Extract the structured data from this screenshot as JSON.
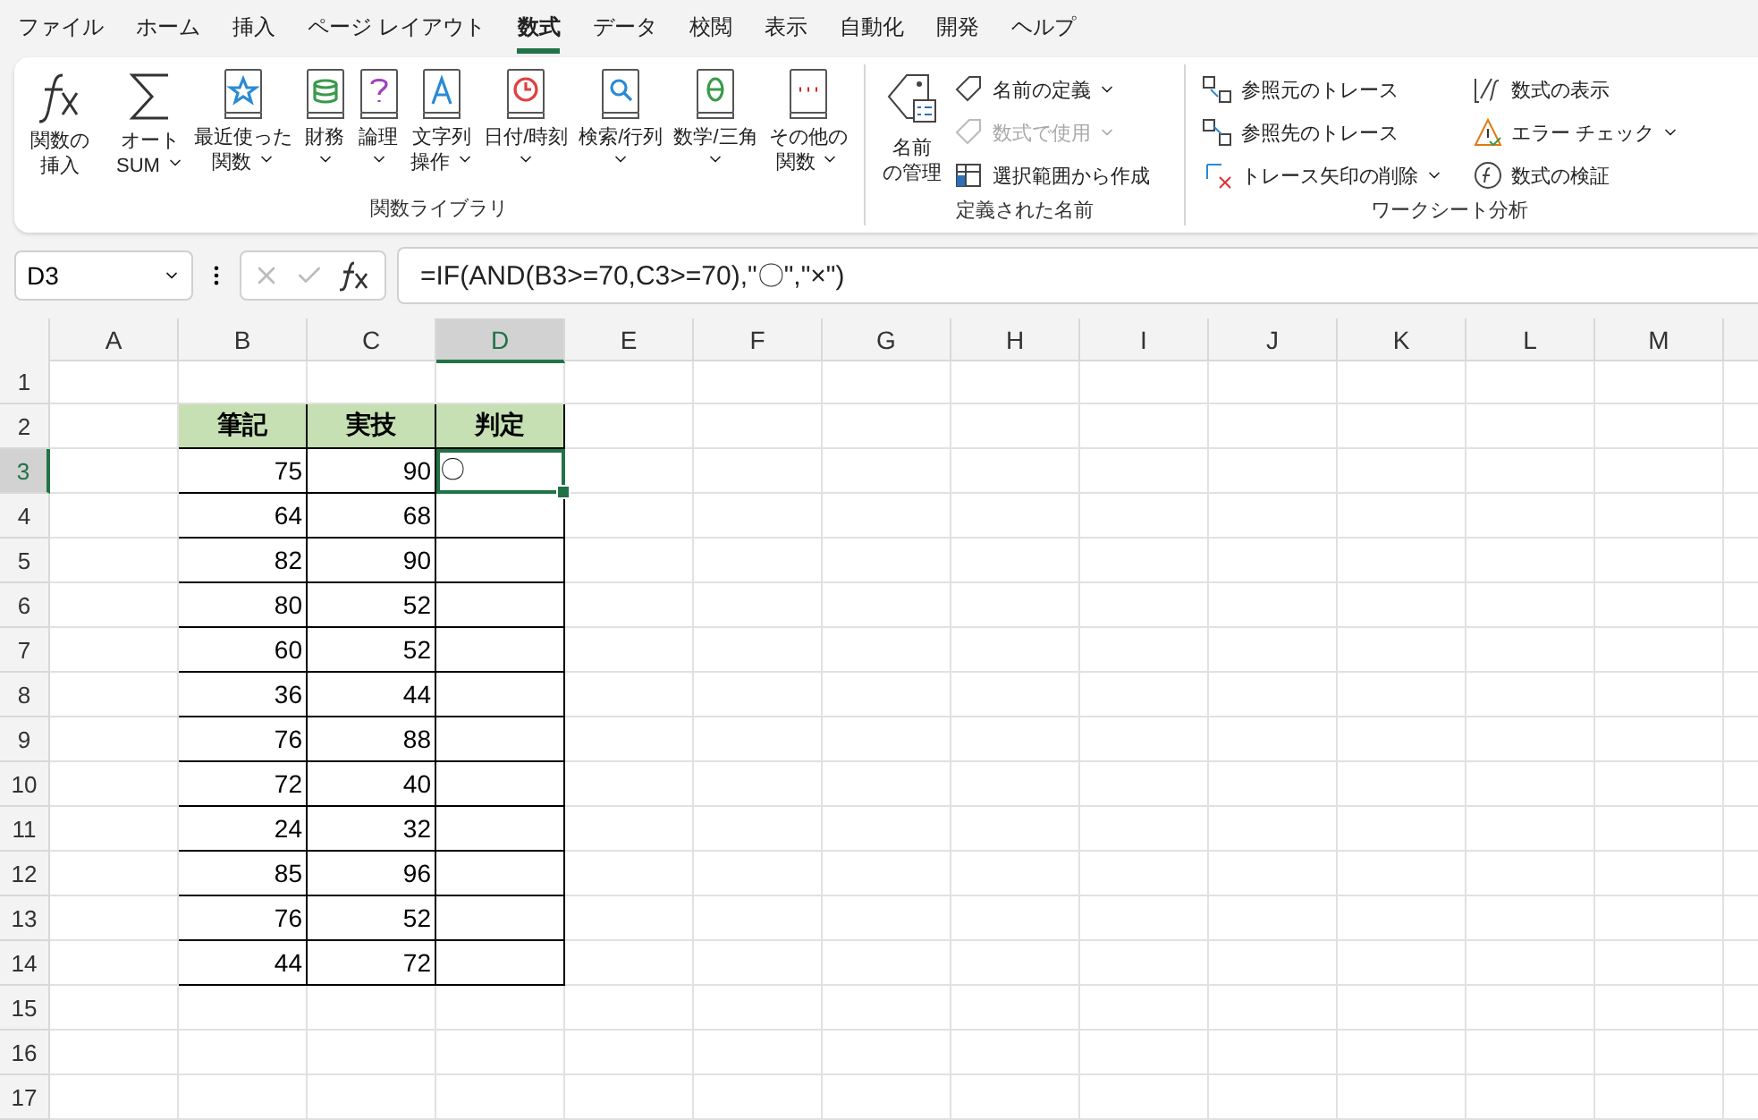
{
  "menu_tabs": [
    {
      "label": "ファイル",
      "selected": false
    },
    {
      "label": "ホーム",
      "selected": false
    },
    {
      "label": "挿入",
      "selected": false
    },
    {
      "label": "ページ レイアウト",
      "selected": false
    },
    {
      "label": "数式",
      "selected": true
    },
    {
      "label": "データ",
      "selected": false
    },
    {
      "label": "校閲",
      "selected": false
    },
    {
      "label": "表示",
      "selected": false
    },
    {
      "label": "自動化",
      "selected": false
    },
    {
      "label": "開発",
      "selected": false
    },
    {
      "label": "ヘルプ",
      "selected": false
    }
  ],
  "ribbon_groups": [
    {
      "label": "関数ライブラリ",
      "buttons": [
        {
          "kind": "large",
          "label": "関数の挿入",
          "dropdown": false
        },
        {
          "kind": "large",
          "label": "オートSUM",
          "dropdown": true
        },
        {
          "kind": "large",
          "label": "最近使った関数",
          "dropdown": true
        },
        {
          "kind": "large",
          "label": "財務",
          "dropdown": true
        },
        {
          "kind": "large",
          "label": "論理",
          "dropdown": true
        },
        {
          "kind": "large",
          "label": "文字列操作",
          "dropdown": true
        },
        {
          "kind": "large",
          "label": "日付/時刻",
          "dropdown": true
        },
        {
          "kind": "large",
          "label": "検索/行列",
          "dropdown": true
        },
        {
          "kind": "large",
          "label": "数学/三角",
          "dropdown": true
        },
        {
          "kind": "large",
          "label": "その他の関数",
          "dropdown": true
        }
      ]
    },
    {
      "label": "定義された名前",
      "buttons": [
        {
          "kind": "large",
          "label": "名前の管理",
          "dropdown": false
        },
        {
          "kind": "small",
          "label": "名前の定義",
          "dropdown": true,
          "disabled": false
        },
        {
          "kind": "small",
          "label": "数式で使用",
          "dropdown": true,
          "disabled": true
        },
        {
          "kind": "small",
          "label": "選択範囲から作成",
          "dropdown": false,
          "disabled": false
        }
      ]
    },
    {
      "label": "ワークシート分析",
      "buttons": [
        {
          "kind": "small",
          "label": "参照元のトレース",
          "dropdown": false,
          "disabled": false
        },
        {
          "kind": "small",
          "label": "参照先のトレース",
          "dropdown": false,
          "disabled": false
        },
        {
          "kind": "small",
          "label": "トレース矢印の削除",
          "dropdown": true,
          "disabled": false
        },
        {
          "kind": "small",
          "label": "数式の表示",
          "dropdown": false,
          "disabled": false
        },
        {
          "kind": "small",
          "label": "エラー チェック",
          "dropdown": true,
          "disabled": false
        },
        {
          "kind": "small",
          "label": "数式の検証",
          "dropdown": false,
          "disabled": false
        }
      ]
    }
  ],
  "formula_bar": {
    "name_box": "D3",
    "formula": "=IF(AND(B3>=70,C3>=70),\"〇\",\"×\")"
  },
  "columns": [
    {
      "label": "A",
      "selected": false
    },
    {
      "label": "B",
      "selected": false
    },
    {
      "label": "C",
      "selected": false
    },
    {
      "label": "D",
      "selected": true
    },
    {
      "label": "E",
      "selected": false
    },
    {
      "label": "F",
      "selected": false
    },
    {
      "label": "G",
      "selected": false
    },
    {
      "label": "H",
      "selected": false
    },
    {
      "label": "I",
      "selected": false
    },
    {
      "label": "J",
      "selected": false
    },
    {
      "label": "K",
      "selected": false
    },
    {
      "label": "L",
      "selected": false
    },
    {
      "label": "M",
      "selected": false
    }
  ],
  "row_headers": [
    {
      "label": "1",
      "selected": false
    },
    {
      "label": "2",
      "selected": false
    },
    {
      "label": "3",
      "selected": true
    },
    {
      "label": "4",
      "selected": false
    },
    {
      "label": "5",
      "selected": false
    },
    {
      "label": "6",
      "selected": false
    },
    {
      "label": "7",
      "selected": false
    },
    {
      "label": "8",
      "selected": false
    },
    {
      "label": "9",
      "selected": false
    },
    {
      "label": "10",
      "selected": false
    },
    {
      "label": "11",
      "selected": false
    },
    {
      "label": "12",
      "selected": false
    },
    {
      "label": "13",
      "selected": false
    },
    {
      "label": "14",
      "selected": false
    },
    {
      "label": "15",
      "selected": false
    },
    {
      "label": "16",
      "selected": false
    },
    {
      "label": "17",
      "selected": false
    }
  ],
  "table": {
    "headers": [
      "筆記",
      "実技",
      "判定"
    ],
    "rows": [
      {
        "values": [
          "75",
          "90"
        ],
        "result": "〇",
        "selected": true
      },
      {
        "values": [
          "64",
          "68"
        ],
        "selected": false
      },
      {
        "values": [
          "82",
          "90"
        ],
        "selected": false
      },
      {
        "values": [
          "80",
          "52"
        ],
        "selected": false
      },
      {
        "values": [
          "60",
          "52"
        ],
        "selected": false
      },
      {
        "values": [
          "36",
          "44"
        ],
        "selected": false
      },
      {
        "values": [
          "76",
          "88"
        ],
        "selected": false
      },
      {
        "values": [
          "72",
          "40"
        ],
        "selected": false
      },
      {
        "values": [
          "24",
          "32"
        ],
        "selected": false
      },
      {
        "values": [
          "85",
          "96"
        ],
        "selected": false
      },
      {
        "values": [
          "76",
          "52"
        ],
        "selected": false
      },
      {
        "values": [
          "44",
          "72"
        ],
        "selected": false
      }
    ]
  }
}
